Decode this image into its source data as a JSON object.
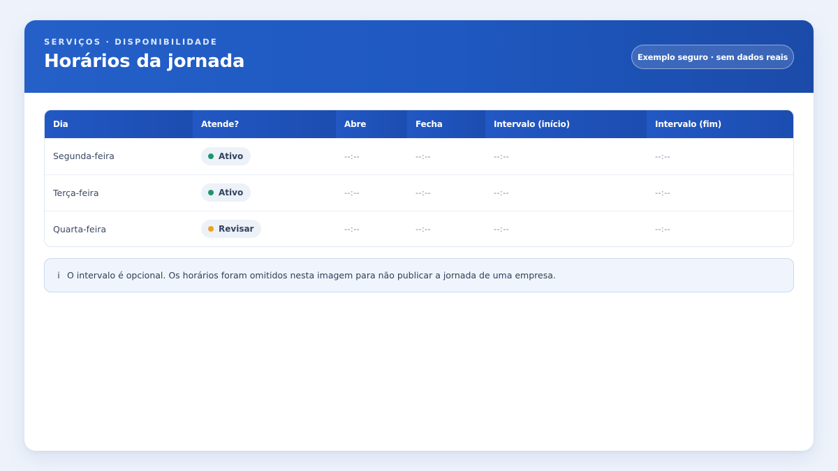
{
  "header": {
    "eyebrow": "SERVIÇOS · DISPONIBILIDADE",
    "title": "Horários da jornada",
    "badge": "Exemplo seguro · sem dados reais"
  },
  "table": {
    "columns": [
      "Dia",
      "Atende?",
      "Abre",
      "Fecha",
      "Intervalo (início)",
      "Intervalo (fim)"
    ],
    "rows": [
      {
        "day": "Segunda-feira",
        "status": "Ativo",
        "status_color": "#1f9470",
        "open": "--:--",
        "close": "--:--",
        "break_start": "--:--",
        "break_end": "--:--"
      },
      {
        "day": "Terça-feira",
        "status": "Ativo",
        "status_color": "#1f9470",
        "open": "--:--",
        "close": "--:--",
        "break_start": "--:--",
        "break_end": "--:--"
      },
      {
        "day": "Quarta-feira",
        "status": "Revisar",
        "status_color": "#eba21c",
        "open": "--:--",
        "close": "--:--",
        "break_start": "--:--",
        "break_end": "--:--"
      }
    ]
  },
  "note": {
    "icon": "info-icon",
    "icon_glyph": "i",
    "text": "O intervalo é opcional. Os horários foram omitidos nesta imagem para não publicar a jornada de uma empresa."
  },
  "colors": {
    "header_blue": "#1e58c0",
    "active_green": "#1f9470",
    "review_amber": "#eba21c"
  }
}
